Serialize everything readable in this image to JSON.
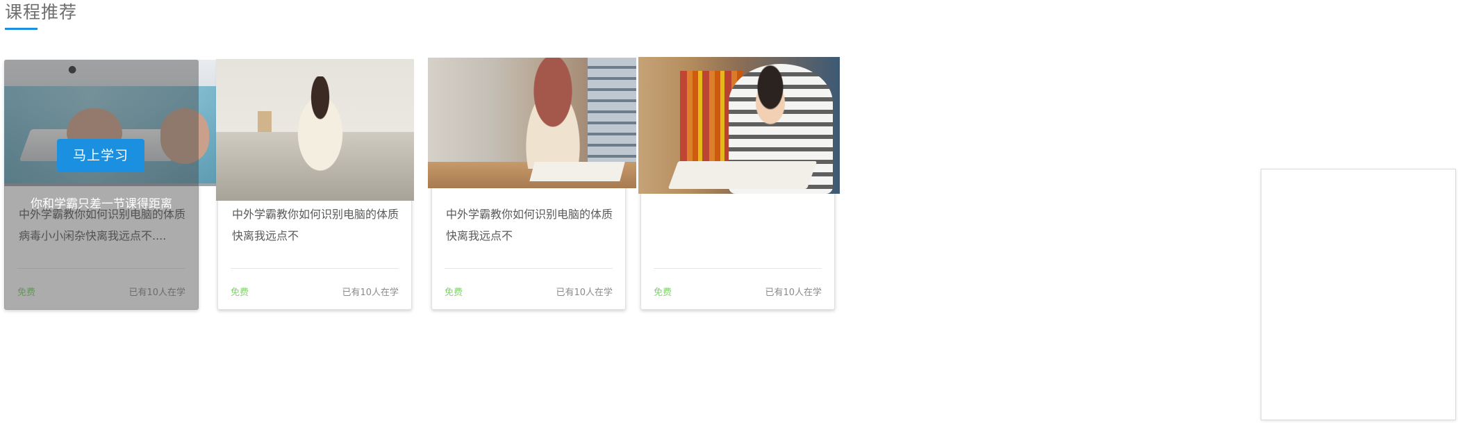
{
  "section": {
    "title": "课程推荐"
  },
  "overlay": {
    "button_label": "马上学习",
    "tagline": "你和学霸只差一节课得距离"
  },
  "cards": [
    {
      "desc_line1": "中外学霸教你如何识别电脑的体质",
      "desc_line2": "病毒小小闲杂快离我远点不....",
      "price": "免费",
      "learners": "已有10人在学"
    },
    {
      "desc_line1": "中外学霸教你如何识别电脑的体质",
      "desc_line2": "快离我远点不",
      "price": "免费",
      "learners": "已有10人在学"
    },
    {
      "desc_line1": "中外学霸教你如何识别电脑的体质",
      "desc_line2": "快离我远点不",
      "price": "免费",
      "learners": "已有10人在学"
    },
    {
      "desc_line1": "",
      "desc_line2": "",
      "price": "免费",
      "learners": "已有10人在学"
    }
  ],
  "colors": {
    "accent": "#1b8fe0",
    "price": "#7fd36a",
    "muted": "#8a8a8a"
  }
}
